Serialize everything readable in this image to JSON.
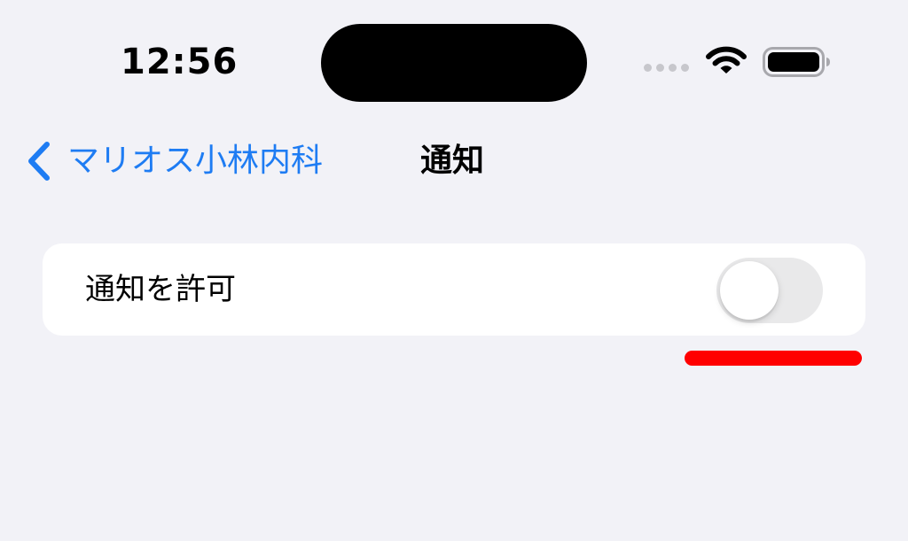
{
  "status_bar": {
    "time": "12:56",
    "icons": [
      "cellular-signal-icon",
      "wifi-icon",
      "battery-icon"
    ]
  },
  "nav_bar": {
    "back_label": "マリオス小林内科",
    "back_icon": "chevron-left-icon",
    "title": "通知"
  },
  "settings": {
    "rows": [
      {
        "label": "通知を許可",
        "toggle_on": false
      }
    ]
  },
  "colors": {
    "background": "#F2F2F7",
    "accent": "#1E7CF3",
    "toggle_off_track": "#E9E9EA",
    "annotation": "#FF0000"
  }
}
